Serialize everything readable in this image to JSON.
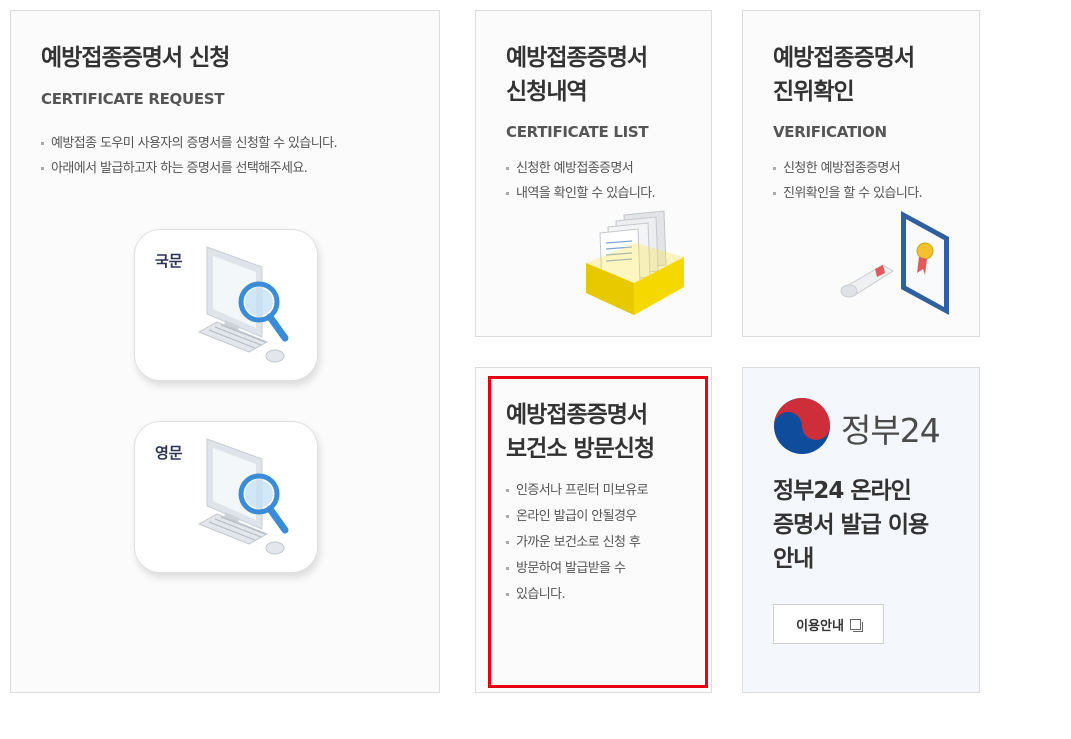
{
  "request": {
    "title": "예방접종증명서 신청",
    "subtitle": "CERTIFICATE REQUEST",
    "bullets": [
      "예방접종 도우미 사용자의 증명서를 신청할 수 있습니다.",
      "아래에서 발급하고자 하는 증명서를 선택해주세요."
    ],
    "korean_label": "국문",
    "english_label": "영문"
  },
  "list": {
    "title_line1": "예방접종증명서",
    "title_line2": "신청내역",
    "subtitle": "CERTIFICATE LIST",
    "bullet_line1": "신청한 예방접종증명서",
    "bullet_line2": "내역을 확인할 수 있습니다."
  },
  "verify": {
    "title_line1": "예방접종증명서",
    "title_line2": "진위확인",
    "subtitle": "VERIFICATION",
    "bullet_line1": "신청한 예방접종증명서",
    "bullet_line2": "진위확인을 할 수 있습니다."
  },
  "visit": {
    "title_line1": "예방접종증명서",
    "title_line2": "보건소 방문신청",
    "bullet_lines": [
      "인증서나 프린터 미보유로",
      "온라인 발급이 안될경우",
      "가까운 보건소로 신청 후",
      "방문하여 발급받을 수",
      "있습니다."
    ]
  },
  "gov24": {
    "brand": "정부24",
    "title_line1": "정부24 온라인",
    "title_line2": "증명서 발급 이용",
    "title_line3": "안내",
    "button_label": "이용안내"
  },
  "icons": [
    "computer-search-icon",
    "document-box-icon",
    "certificate-scroll-icon",
    "taegeuk-logo-icon",
    "copy-icon"
  ],
  "colors": {
    "highlight": "#e60012",
    "gov_bg": "#f4f7fb",
    "accent_red": "#cd2e3a",
    "accent_blue": "#0f4c9c"
  }
}
